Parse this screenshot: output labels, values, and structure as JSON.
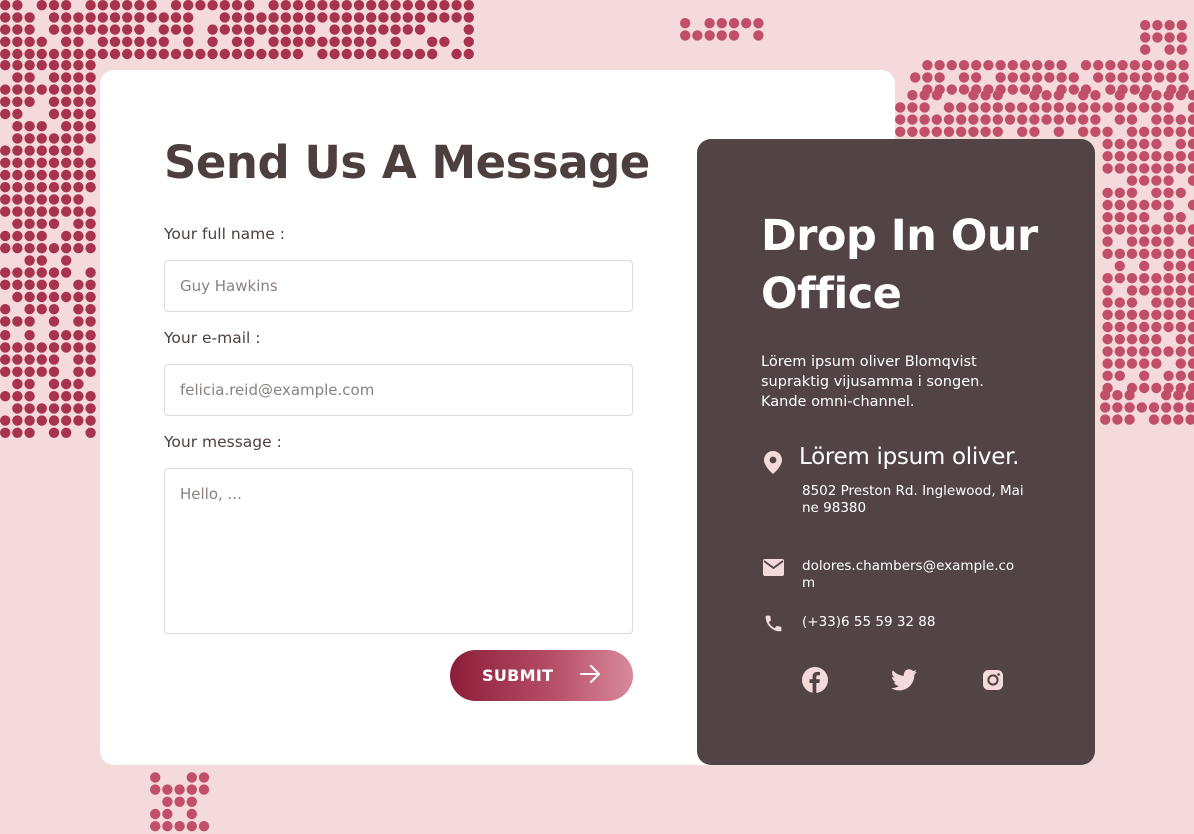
{
  "form": {
    "title": "Send Us A Message",
    "name_label": "Your full name :",
    "name_placeholder": "Guy Hawkins",
    "email_label": "Your e-mail :",
    "email_placeholder": "felicia.reid@example.com",
    "message_label": "Your message :",
    "message_placeholder": "Hello, ...",
    "submit_label": "SUBMIT"
  },
  "office": {
    "title": "Drop In Our Office",
    "description": "Lörem ipsum oliver Blomqvist supraktig vijusamma i songen. Kande omni-channel.",
    "address_heading": "Lörem ipsum oliver.",
    "address": "8502 Preston Rd. Inglewood, Maine 98380",
    "email": "dolores.chambers@example.com",
    "phone": "(+33)6 55 59 32 88"
  },
  "icons": {
    "location": "location-pin-icon",
    "email": "envelope-icon",
    "phone": "phone-icon",
    "submit_arrow": "arrow-right-icon",
    "social": [
      "facebook-icon",
      "twitter-icon",
      "instagram-icon"
    ]
  },
  "colors": {
    "background": "#f4dadb",
    "dots": "#c14f6a",
    "card": "#ffffff",
    "office_panel": "#524444",
    "heading": "#4e3f3f",
    "button_gradient_start": "#8c1d38",
    "button_gradient_end": "#d9899c"
  }
}
